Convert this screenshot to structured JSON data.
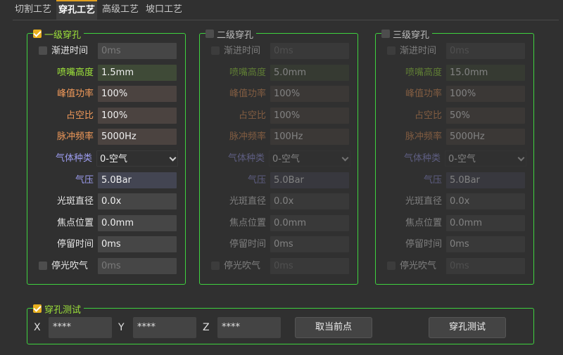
{
  "tabs": [
    "切割工艺",
    "穿孔工艺",
    "高级工艺",
    "坡口工艺"
  ],
  "active_tab": 1,
  "levels": [
    {
      "title": "一级穿孔",
      "checked": true,
      "ramp_label": "渐进时间",
      "ramp_value": "0ms",
      "height_label": "喷嘴高度",
      "height_value": "1.5mm",
      "power_label": "峰值功率",
      "power_value": "100%",
      "duty_label": "占空比",
      "duty_value": "100%",
      "freq_label": "脉冲频率",
      "freq_value": "5000Hz",
      "gas_label": "气体种类",
      "gas_value": "0-空气",
      "pressure_label": "气压",
      "pressure_value": "5.0Bar",
      "spot_label": "光斑直径",
      "spot_value": "0.0x",
      "focus_label": "焦点位置",
      "focus_value": "0.0mm",
      "dwell_label": "停留时间",
      "dwell_value": "0ms",
      "blow_label": "停光吹气",
      "blow_value": "0ms"
    },
    {
      "title": "二级穿孔",
      "checked": false,
      "ramp_label": "渐进时间",
      "ramp_value": "0ms",
      "height_label": "喷嘴高度",
      "height_value": "5.0mm",
      "power_label": "峰值功率",
      "power_value": "100%",
      "duty_label": "占空比",
      "duty_value": "100%",
      "freq_label": "脉冲频率",
      "freq_value": "100Hz",
      "gas_label": "气体种类",
      "gas_value": "0-空气",
      "pressure_label": "气压",
      "pressure_value": "5.0Bar",
      "spot_label": "光斑直径",
      "spot_value": "0.0x",
      "focus_label": "焦点位置",
      "focus_value": "0.0mm",
      "dwell_label": "停留时间",
      "dwell_value": "0ms",
      "blow_label": "停光吹气",
      "blow_value": "0ms"
    },
    {
      "title": "三级穿孔",
      "checked": false,
      "ramp_label": "渐进时间",
      "ramp_value": "0ms",
      "height_label": "喷嘴高度",
      "height_value": "15.0mm",
      "power_label": "峰值功率",
      "power_value": "100%",
      "duty_label": "占空比",
      "duty_value": "50%",
      "freq_label": "脉冲频率",
      "freq_value": "5000Hz",
      "gas_label": "气体种类",
      "gas_value": "0-空气",
      "pressure_label": "气压",
      "pressure_value": "5.0Bar",
      "spot_label": "光斑直径",
      "spot_value": "0.0x",
      "focus_label": "焦点位置",
      "focus_value": "0.0mm",
      "dwell_label": "停留时间",
      "dwell_value": "0ms",
      "blow_label": "停光吹气",
      "blow_value": "0ms"
    }
  ],
  "test": {
    "title": "穿孔测试",
    "checked": true,
    "x_label": "X",
    "x_value": "****",
    "y_label": "Y",
    "y_value": "****",
    "z_label": "Z",
    "z_value": "****",
    "get_point_label": "取当前点",
    "test_button_label": "穿孔测试"
  },
  "colors": {
    "group_border": "#3fd23f",
    "accent_tab": "#e0a020",
    "checkbox_on": "#e8b020",
    "label_green": "#9ee33a",
    "label_orange": "#f29a5a",
    "label_purple": "#9d9df0"
  }
}
